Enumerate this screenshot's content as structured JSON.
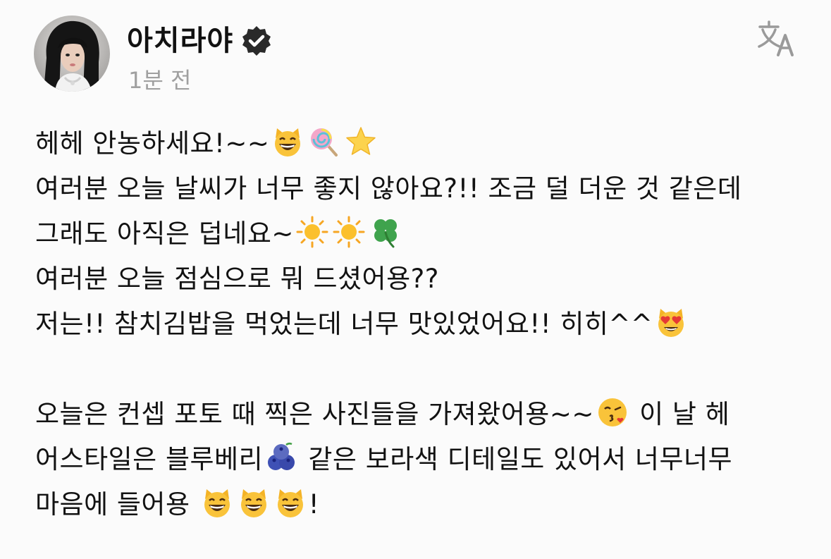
{
  "author": {
    "name": "아치라야",
    "verified": true,
    "timestamp": "1분 전"
  },
  "icons": {
    "translate": "translate-icon",
    "verified": "verified-badge-icon"
  },
  "colors": {
    "text": "#121212",
    "muted": "#a0a0a0",
    "background": "#fbfbfb",
    "verified_badge": "#2a2a2a"
  },
  "post": {
    "lines": [
      {
        "text": "헤헤 안농하세요!~~",
        "emojis": [
          "grinning-cat-emoji",
          "lollipop-emoji",
          "star-emoji"
        ]
      },
      {
        "text": "여러분 오늘 날씨가 너무 좋지 않아요?!! 조금 덜 더운 것 같은데"
      },
      {
        "text": "그래도 아직은 덥네요~",
        "emojis": [
          "sun-emoji",
          "sun-emoji",
          "four-leaf-clover-emoji"
        ]
      },
      {
        "text": "여러분 오늘 점심으로 뭐 드셨어용??"
      },
      {
        "text": "저는!! 참치김밥을 먹었는데 너무 맛있었어요!! 히히^^",
        "emojis": [
          "heart-eyes-cat-emoji"
        ]
      },
      {
        "text": ""
      },
      {
        "text": "오늘은 컨셉 포토 때 찍은 사진들을 가져왔어용~~",
        "emojis": [
          "kissing-face-emoji"
        ],
        "after": " 이 날 헤"
      },
      {
        "text": "어스타일은 블루베리",
        "emojis": [
          "blueberries-emoji"
        ],
        "after": " 같은 보라색 디테일도 있어서 너무너무"
      },
      {
        "text": "마음에 들어용 ",
        "emojis": [
          "grinning-cat-emoji",
          "grinning-cat-emoji",
          "grinning-cat-emoji"
        ],
        "after": "!"
      }
    ]
  }
}
